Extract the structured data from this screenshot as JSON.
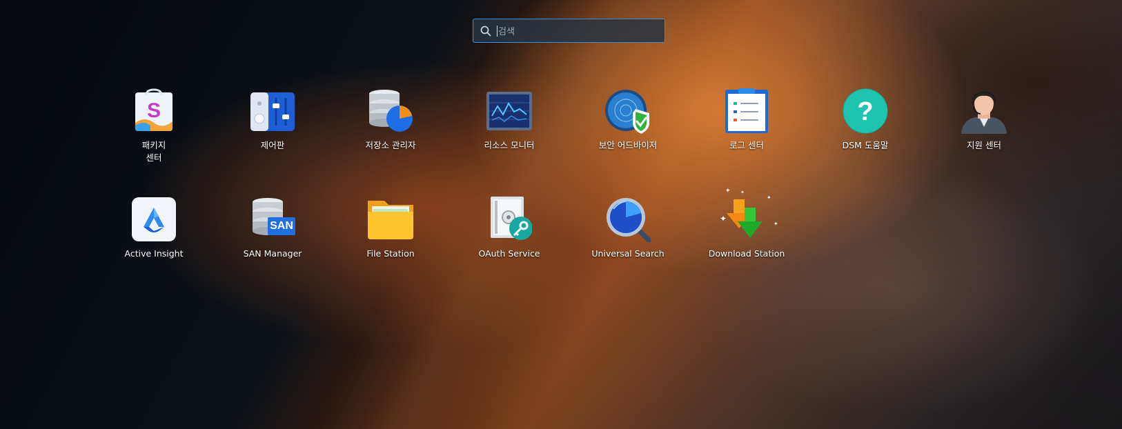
{
  "search": {
    "placeholder": "검색"
  },
  "apps": [
    {
      "label": "패키지\n센터",
      "icon": "package-center-icon"
    },
    {
      "label": "제어판",
      "icon": "control-panel-icon"
    },
    {
      "label": "저장소 관리자",
      "icon": "storage-manager-icon"
    },
    {
      "label": "리소스 모니터",
      "icon": "resource-monitor-icon"
    },
    {
      "label": "보안 어드바이저",
      "icon": "security-advisor-icon"
    },
    {
      "label": "로그 센터",
      "icon": "log-center-icon"
    },
    {
      "label": "DSM 도움말",
      "icon": "help-icon"
    },
    {
      "label": "지원 센터",
      "icon": "support-center-icon"
    },
    {
      "label": "Active Insight",
      "icon": "active-insight-icon"
    },
    {
      "label": "SAN Manager",
      "icon": "san-manager-icon"
    },
    {
      "label": "File Station",
      "icon": "file-station-icon"
    },
    {
      "label": "OAuth Service",
      "icon": "oauth-service-icon"
    },
    {
      "label": "Universal Search",
      "icon": "universal-search-icon"
    },
    {
      "label": "Download Station",
      "icon": "download-station-icon"
    }
  ],
  "badges": {
    "san_text": "SAN"
  }
}
